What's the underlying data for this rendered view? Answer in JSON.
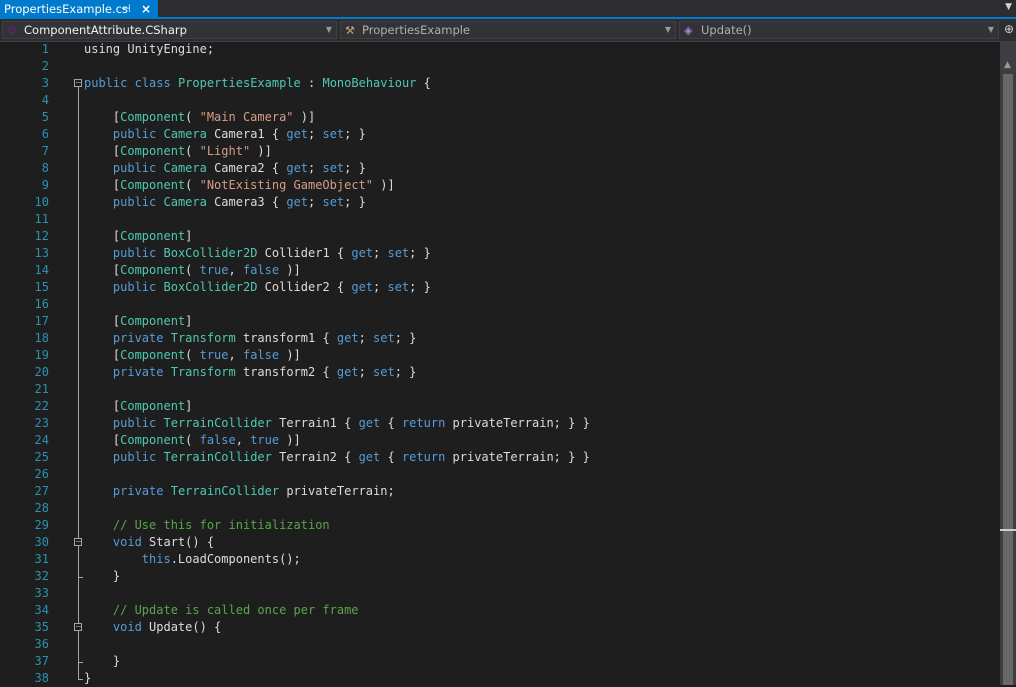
{
  "tab": {
    "title": "PropertiesExample.cs",
    "pin_icon": "pin-icon",
    "close_icon": "close-icon"
  },
  "nav": {
    "project": "ComponentAttribute.CSharp",
    "type": "PropertiesExample",
    "member": "Update()"
  },
  "code": [
    [
      [
        "t",
        "using UnityEngine;"
      ]
    ],
    [],
    [
      [
        "k",
        "public"
      ],
      [
        "t",
        " "
      ],
      [
        "k",
        "class"
      ],
      [
        "t",
        " "
      ],
      [
        "y",
        "PropertiesExample"
      ],
      [
        "t",
        " : "
      ],
      [
        "y",
        "MonoBehaviour"
      ],
      [
        "t",
        " {"
      ]
    ],
    [],
    [
      [
        "t",
        "    ["
      ],
      [
        "y",
        "Component"
      ],
      [
        "t",
        "( "
      ],
      [
        "s",
        "\"Main Camera\""
      ],
      [
        "t",
        " )]"
      ]
    ],
    [
      [
        "t",
        "    "
      ],
      [
        "k",
        "public"
      ],
      [
        "t",
        " "
      ],
      [
        "y",
        "Camera"
      ],
      [
        "t",
        " Camera1 { "
      ],
      [
        "k",
        "get"
      ],
      [
        "t",
        "; "
      ],
      [
        "k",
        "set"
      ],
      [
        "t",
        "; }"
      ]
    ],
    [
      [
        "t",
        "    ["
      ],
      [
        "y",
        "Component"
      ],
      [
        "t",
        "( "
      ],
      [
        "s",
        "\"Light\""
      ],
      [
        "t",
        " )]"
      ]
    ],
    [
      [
        "t",
        "    "
      ],
      [
        "k",
        "public"
      ],
      [
        "t",
        " "
      ],
      [
        "y",
        "Camera"
      ],
      [
        "t",
        " Camera2 { "
      ],
      [
        "k",
        "get"
      ],
      [
        "t",
        "; "
      ],
      [
        "k",
        "set"
      ],
      [
        "t",
        "; }"
      ]
    ],
    [
      [
        "t",
        "    ["
      ],
      [
        "y",
        "Component"
      ],
      [
        "t",
        "( "
      ],
      [
        "s",
        "\"NotExisting GameObject\""
      ],
      [
        "t",
        " )]"
      ]
    ],
    [
      [
        "t",
        "    "
      ],
      [
        "k",
        "public"
      ],
      [
        "t",
        " "
      ],
      [
        "y",
        "Camera"
      ],
      [
        "t",
        " Camera3 { "
      ],
      [
        "k",
        "get"
      ],
      [
        "t",
        "; "
      ],
      [
        "k",
        "set"
      ],
      [
        "t",
        "; }"
      ]
    ],
    [],
    [
      [
        "t",
        "    ["
      ],
      [
        "y",
        "Component"
      ],
      [
        "t",
        "]"
      ]
    ],
    [
      [
        "t",
        "    "
      ],
      [
        "k",
        "public"
      ],
      [
        "t",
        " "
      ],
      [
        "y",
        "BoxCollider2D"
      ],
      [
        "t",
        " Collider1 { "
      ],
      [
        "k",
        "get"
      ],
      [
        "t",
        "; "
      ],
      [
        "k",
        "set"
      ],
      [
        "t",
        "; }"
      ]
    ],
    [
      [
        "t",
        "    ["
      ],
      [
        "y",
        "Component"
      ],
      [
        "t",
        "( "
      ],
      [
        "k",
        "true"
      ],
      [
        "t",
        ", "
      ],
      [
        "k",
        "false"
      ],
      [
        "t",
        " )]"
      ]
    ],
    [
      [
        "t",
        "    "
      ],
      [
        "k",
        "public"
      ],
      [
        "t",
        " "
      ],
      [
        "y",
        "BoxCollider2D"
      ],
      [
        "t",
        " Collider2 { "
      ],
      [
        "k",
        "get"
      ],
      [
        "t",
        "; "
      ],
      [
        "k",
        "set"
      ],
      [
        "t",
        "; }"
      ]
    ],
    [],
    [
      [
        "t",
        "    ["
      ],
      [
        "y",
        "Component"
      ],
      [
        "t",
        "]"
      ]
    ],
    [
      [
        "t",
        "    "
      ],
      [
        "k",
        "private"
      ],
      [
        "t",
        " "
      ],
      [
        "y",
        "Transform"
      ],
      [
        "t",
        " transform1 { "
      ],
      [
        "k",
        "get"
      ],
      [
        "t",
        "; "
      ],
      [
        "k",
        "set"
      ],
      [
        "t",
        "; }"
      ]
    ],
    [
      [
        "t",
        "    ["
      ],
      [
        "y",
        "Component"
      ],
      [
        "t",
        "( "
      ],
      [
        "k",
        "true"
      ],
      [
        "t",
        ", "
      ],
      [
        "k",
        "false"
      ],
      [
        "t",
        " )]"
      ]
    ],
    [
      [
        "t",
        "    "
      ],
      [
        "k",
        "private"
      ],
      [
        "t",
        " "
      ],
      [
        "y",
        "Transform"
      ],
      [
        "t",
        " transform2 { "
      ],
      [
        "k",
        "get"
      ],
      [
        "t",
        "; "
      ],
      [
        "k",
        "set"
      ],
      [
        "t",
        "; }"
      ]
    ],
    [],
    [
      [
        "t",
        "    ["
      ],
      [
        "y",
        "Component"
      ],
      [
        "t",
        "]"
      ]
    ],
    [
      [
        "t",
        "    "
      ],
      [
        "k",
        "public"
      ],
      [
        "t",
        " "
      ],
      [
        "y",
        "TerrainCollider"
      ],
      [
        "t",
        " Terrain1 { "
      ],
      [
        "k",
        "get"
      ],
      [
        "t",
        " { "
      ],
      [
        "k",
        "return"
      ],
      [
        "t",
        " privateTerrain; } }"
      ]
    ],
    [
      [
        "t",
        "    ["
      ],
      [
        "y",
        "Component"
      ],
      [
        "t",
        "( "
      ],
      [
        "k",
        "false"
      ],
      [
        "t",
        ", "
      ],
      [
        "k",
        "true"
      ],
      [
        "t",
        " )]"
      ]
    ],
    [
      [
        "t",
        "    "
      ],
      [
        "k",
        "public"
      ],
      [
        "t",
        " "
      ],
      [
        "y",
        "TerrainCollider"
      ],
      [
        "t",
        " Terrain2 { "
      ],
      [
        "k",
        "get"
      ],
      [
        "t",
        " { "
      ],
      [
        "k",
        "return"
      ],
      [
        "t",
        " privateTerrain; } }"
      ]
    ],
    [],
    [
      [
        "t",
        "    "
      ],
      [
        "k",
        "private"
      ],
      [
        "t",
        " "
      ],
      [
        "y",
        "TerrainCollider"
      ],
      [
        "t",
        " privateTerrain;"
      ]
    ],
    [],
    [
      [
        "c",
        "    // Use this for initialization"
      ]
    ],
    [
      [
        "t",
        "    "
      ],
      [
        "k",
        "void"
      ],
      [
        "t",
        " Start() {"
      ]
    ],
    [
      [
        "t",
        "        "
      ],
      [
        "k",
        "this"
      ],
      [
        "t",
        ".LoadComponents();"
      ]
    ],
    [
      [
        "t",
        "    }"
      ]
    ],
    [],
    [
      [
        "c",
        "    // Update is called once per frame"
      ]
    ],
    [
      [
        "t",
        "    "
      ],
      [
        "k",
        "void"
      ],
      [
        "t",
        " Update() {"
      ]
    ],
    [],
    [
      [
        "t",
        "    }"
      ]
    ],
    [
      [
        "t",
        "}"
      ]
    ]
  ],
  "colors": {
    "keyword": "#569cd6",
    "type": "#4ec9b0",
    "string": "#d69d85",
    "comment": "#57a64a",
    "line_number": "#2b91af",
    "accent": "#007acc"
  }
}
